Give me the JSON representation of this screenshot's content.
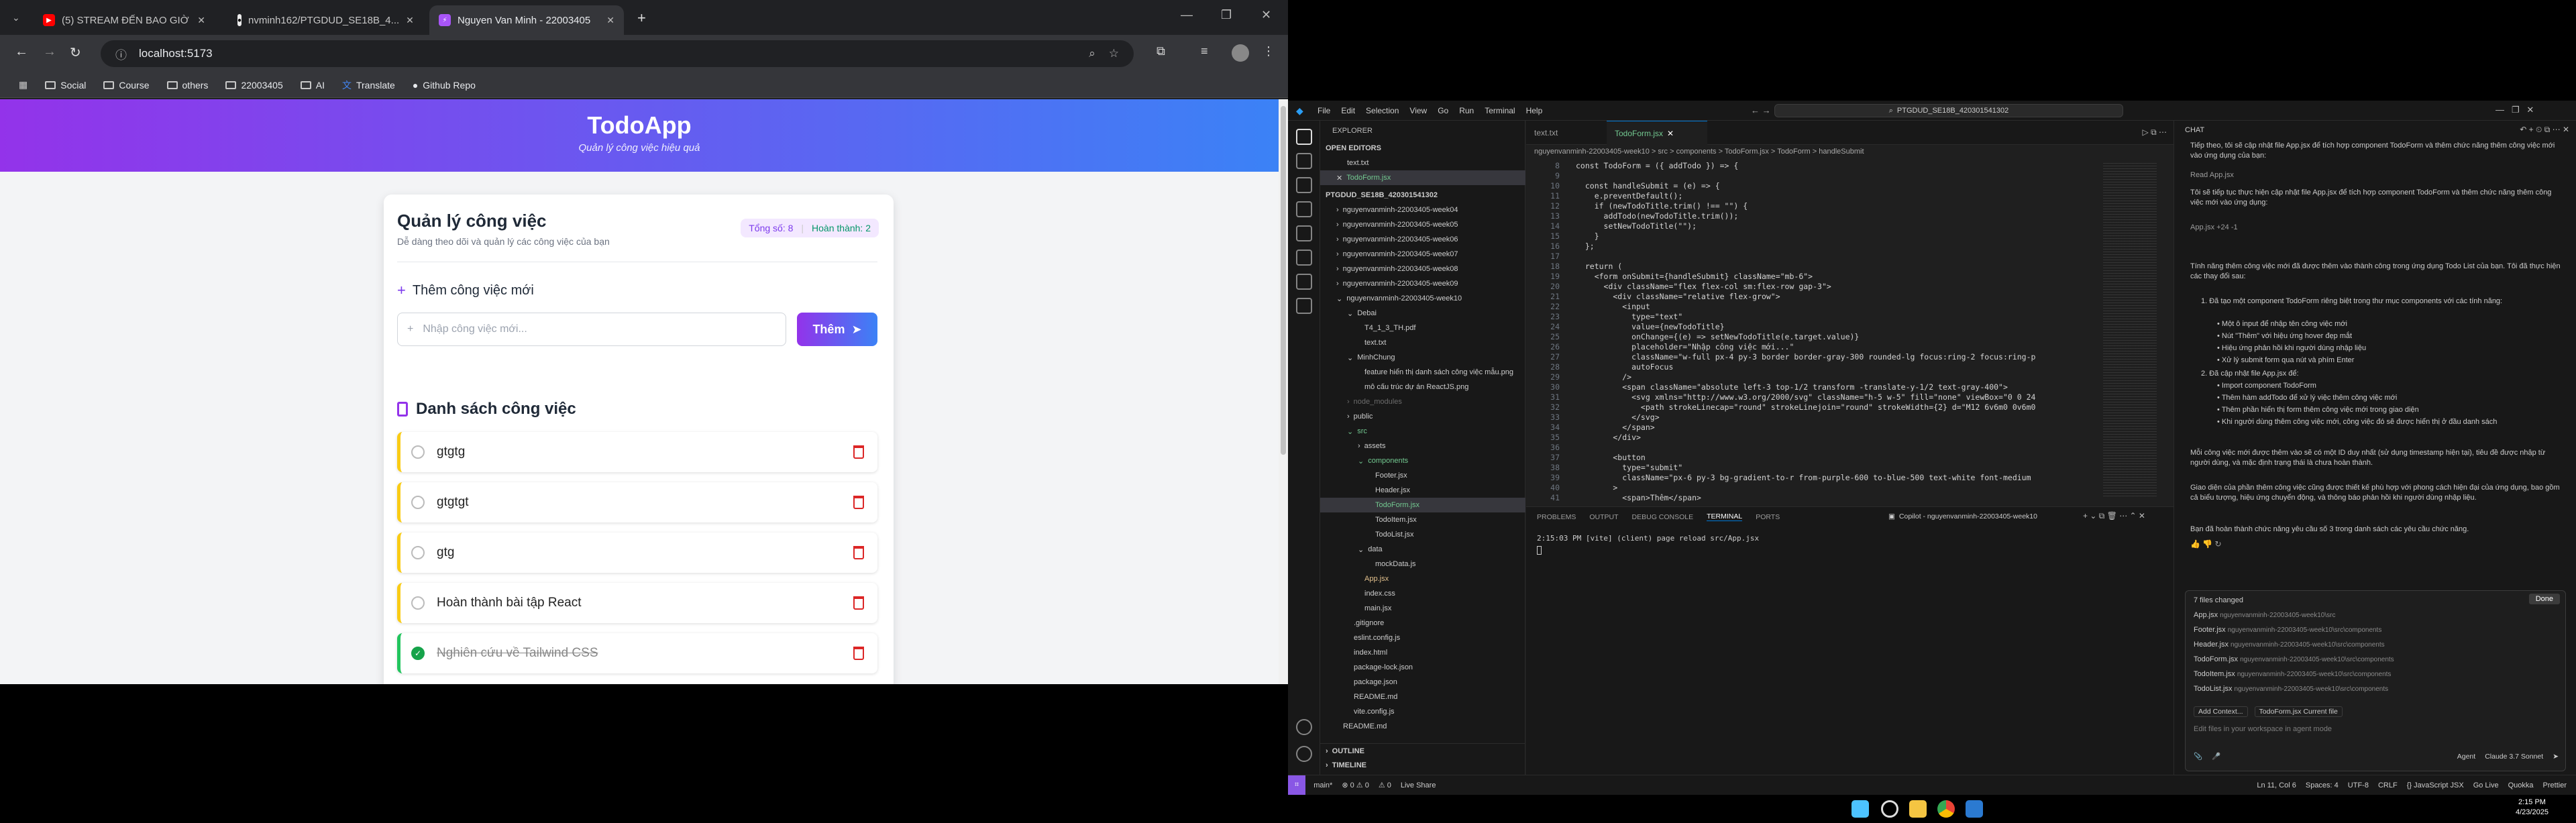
{
  "chrome": {
    "tabs": [
      {
        "title": "(5) STREAM ĐẾN BAO GIỜ"
      },
      {
        "title": "nvminh162/PTGDUD_SE18B_4..."
      },
      {
        "title": "Nguyen Van Minh - 22003405"
      }
    ],
    "url": "localhost:5173",
    "bookmarks": [
      "Social",
      "Course",
      "others",
      "22003405",
      "AI",
      "Translate",
      "Github Repo"
    ]
  },
  "app": {
    "title": "TodoApp",
    "subtitle": "Quản lý công việc hiệu quả",
    "card_title": "Quản lý công việc",
    "card_subtitle": "Dễ dàng theo dõi và quản lý các công việc của bạn",
    "total": "Tổng số: 8",
    "completed": "Hoàn thành: 2",
    "add_heading": "Thêm công việc mới",
    "input_placeholder": "Nhập công việc mới...",
    "add_button": "Thêm",
    "list_heading": "Danh sách công việc",
    "todos": [
      {
        "text": "gtgtg",
        "done": false
      },
      {
        "text": "gtgtgt",
        "done": false
      },
      {
        "text": "gtg",
        "done": false
      },
      {
        "text": "Hoàn thành bài tập React",
        "done": false
      },
      {
        "text": "Nghiên cứu về Tailwind CSS",
        "done": true
      }
    ]
  },
  "taskbar": {
    "time": "2:15 PM",
    "date": "4/23/2025"
  },
  "vscode": {
    "menu": [
      "File",
      "Edit",
      "Selection",
      "View",
      "Go",
      "Run",
      "Terminal",
      "Help"
    ],
    "search": "PTGDUD_SE18B_420301541302",
    "explorer_title": "EXPLORER",
    "open_editors": "OPEN EDITORS",
    "open_files": [
      "text.txt",
      "TodoForm.jsx"
    ],
    "workspace": "PTGDUD_SE18B_420301541302",
    "tree": [
      "nguyenvanminh-22003405-week04",
      "nguyenvanminh-22003405-week05",
      "nguyenvanminh-22003405-week06",
      "nguyenvanminh-22003405-week07",
      "nguyenvanminh-22003405-week08",
      "nguyenvanminh-22003405-week09",
      "nguyenvanminh-22003405-week10",
      "Debai",
      "T4_1_3_TH.pdf",
      "text.txt",
      "MinhChung",
      "feature hiển thị danh sách công việc mẫu.png",
      "mô cấu trúc dự án ReactJS.png",
      "node_modules",
      "public",
      "src",
      "assets",
      "components",
      "Footer.jsx",
      "Header.jsx",
      "TodoForm.jsx",
      "TodoItem.jsx",
      "TodoList.jsx",
      "data",
      "mockData.js",
      "App.jsx",
      "index.css",
      "main.jsx",
      ".gitignore",
      "eslint.config.js",
      "index.html",
      "package-lock.json",
      "package.json",
      "README.md",
      "vite.config.js",
      "README.md"
    ],
    "editor_tabs": [
      "text.txt",
      "TodoForm.jsx"
    ],
    "breadcrumb": "nguyenvanminh-22003405-week10 > src > components > TodoForm.jsx > TodoForm > handleSubmit",
    "code": [
      {
        "n": "8",
        "t": "const TodoForm = ({ addTodo }) => {"
      },
      {
        "n": "9",
        "t": ""
      },
      {
        "n": "10",
        "t": "  const handleSubmit = (e) => {"
      },
      {
        "n": "11",
        "t": "    e.preventDefault();"
      },
      {
        "n": "12",
        "t": "    if (newTodoTitle.trim() !== \"\") {"
      },
      {
        "n": "13",
        "t": "      addTodo(newTodoTitle.trim());"
      },
      {
        "n": "14",
        "t": "      setNewTodoTitle(\"\");"
      },
      {
        "n": "15",
        "t": "    }"
      },
      {
        "n": "16",
        "t": "  };"
      },
      {
        "n": "17",
        "t": ""
      },
      {
        "n": "18",
        "t": "  return ("
      },
      {
        "n": "19",
        "t": "    <form onSubmit={handleSubmit} className=\"mb-6\">"
      },
      {
        "n": "20",
        "t": "      <div className=\"flex flex-col sm:flex-row gap-3\">"
      },
      {
        "n": "21",
        "t": "        <div className=\"relative flex-grow\">"
      },
      {
        "n": "22",
        "t": "          <input"
      },
      {
        "n": "23",
        "t": "            type=\"text\""
      },
      {
        "n": "24",
        "t": "            value={newTodoTitle}"
      },
      {
        "n": "25",
        "t": "            onChange={(e) => setNewTodoTitle(e.target.value)}"
      },
      {
        "n": "26",
        "t": "            placeholder=\"Nhập công việc mới...\""
      },
      {
        "n": "27",
        "t": "            className=\"w-full px-4 py-3 border border-gray-300 rounded-lg focus:ring-2 focus:ring-p"
      },
      {
        "n": "28",
        "t": "            autoFocus"
      },
      {
        "n": "29",
        "t": "          />"
      },
      {
        "n": "30",
        "t": "          <span className=\"absolute left-3 top-1/2 transform -translate-y-1/2 text-gray-400\">"
      },
      {
        "n": "31",
        "t": "            <svg xmlns=\"http://www.w3.org/2000/svg\" className=\"h-5 w-5\" fill=\"none\" viewBox=\"0 0 24"
      },
      {
        "n": "32",
        "t": "              <path strokeLinecap=\"round\" strokeLinejoin=\"round\" strokeWidth={2} d=\"M12 6v6m0 0v6m0"
      },
      {
        "n": "33",
        "t": "            </svg>"
      },
      {
        "n": "34",
        "t": "          </span>"
      },
      {
        "n": "35",
        "t": "        </div>"
      },
      {
        "n": "36",
        "t": ""
      },
      {
        "n": "37",
        "t": "        <button"
      },
      {
        "n": "38",
        "t": "          type=\"submit\""
      },
      {
        "n": "39",
        "t": "          className=\"px-6 py-3 bg-gradient-to-r from-purple-600 to-blue-500 text-white font-medium"
      },
      {
        "n": "40",
        "t": "        >"
      },
      {
        "n": "41",
        "t": "          <span>Thêm</span>"
      }
    ],
    "panel_tabs": [
      "PROBLEMS",
      "OUTPUT",
      "DEBUG CONSOLE",
      "TERMINAL",
      "PORTS"
    ],
    "terminal_name": "Copilot - nguyenvanminh-22003405-week10",
    "terminal_line": "2:15:03 PM [vite] (client) page reload src/App.jsx",
    "outline": "OUTLINE",
    "timeline": "TIMELINE",
    "chat_title": "CHAT",
    "chat_paragraphs": [
      "Tiếp theo, tôi sẽ cập nhật file App.jsx để tích hợp component TodoForm và thêm chức năng thêm công việc mới vào ứng dụng của bạn:",
      "Read  App.jsx",
      "Tôi sẽ tiếp tục thực hiện cập nhật file App.jsx để tích hợp component TodoForm và thêm chức năng thêm công việc mới vào ứng dụng:",
      "App.jsx +24 -1",
      "Tính năng thêm công việc mới đã được thêm vào thành công trong ứng dụng Todo List của bạn. Tôi đã thực hiện các thay đổi sau:",
      "1. Đã tạo một component TodoForm riêng biệt trong thư mục components với các tính năng:",
      "• Một ô input để nhập tên công việc mới",
      "• Nút \"Thêm\" với hiệu ứng hover đẹp mắt",
      "• Hiệu ứng phản hồi khi người dùng nhập liệu",
      "• Xử lý submit form qua nút và phím Enter",
      "2. Đã cập nhật file App.jsx để:",
      "• Import component TodoForm",
      "• Thêm hàm addTodo để xử lý việc thêm công việc mới",
      "• Thêm phần hiển thị form thêm công việc mới trong giao diện",
      "• Khi người dùng thêm công việc mới, công việc đó sẽ được hiển thị ở đầu danh sách",
      "Mỗi công việc mới được thêm vào sẽ có một ID duy nhất (sử dụng timestamp hiện tại), tiêu đề được nhập từ người dùng, và mặc định trạng thái là chưa hoàn thành.",
      "Giao diện của phần thêm công việc cũng được thiết kế phù hợp với phong cách hiện đại của ứng dụng, bao gồm cả biểu tượng, hiệu ứng chuyển động, và thông báo phản hồi khi người dùng nhập liệu.",
      "Bạn đã hoàn thành chức năng yêu cầu số 3 trong danh sách các yêu cầu chức năng."
    ],
    "files_changed_title": "7 files changed",
    "files_changed_done": "Done",
    "files_changed": [
      {
        "name": "App.jsx",
        "path": "nguyenvanminh-22003405-week10\\src"
      },
      {
        "name": "Footer.jsx",
        "path": "nguyenvanminh-22003405-week10\\src\\components"
      },
      {
        "name": "Header.jsx",
        "path": "nguyenvanminh-22003405-week10\\src\\components"
      },
      {
        "name": "TodoForm.jsx",
        "path": "nguyenvanminh-22003405-week10\\src\\components"
      },
      {
        "name": "TodoItem.jsx",
        "path": "nguyenvanminh-22003405-week10\\src\\components"
      },
      {
        "name": "TodoList.jsx",
        "path": "nguyenvanminh-22003405-week10\\src\\components"
      }
    ],
    "add_context": "Add Context...",
    "current_file": "TodoForm.jsx  Current file",
    "chat_input_placeholder": "Edit files in your workspace in agent mode",
    "agent_label": "Agent",
    "model_label": "Claude 3.7 Sonnet",
    "status_left": [
      "main*",
      "⊗ 0 ⚠ 0",
      "⚠ 0",
      "Live Share"
    ],
    "status_right": [
      "Ln 11, Col 6",
      "Spaces: 4",
      "UTF-8",
      "CRLF",
      "{} JavaScript JSX",
      "Go Live",
      "Quokka",
      "Prettier"
    ]
  },
  "colors": {
    "accent_purple": "#9333ea",
    "accent_blue": "#3b82f6",
    "danger": "#dc2626",
    "done": "#22c55e",
    "pending": "#facc15"
  }
}
